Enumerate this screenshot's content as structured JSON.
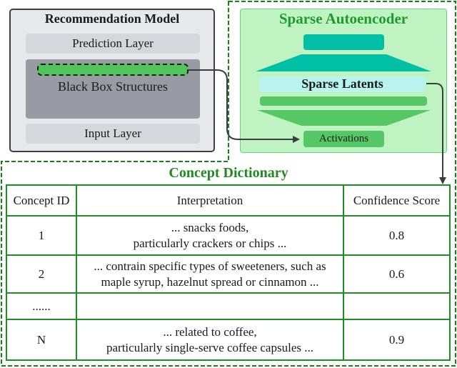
{
  "recommendation_model": {
    "title": "Recommendation Model",
    "prediction_layer": "Prediction Layer",
    "black_box": "Black Box Structures",
    "input_layer": "Input Layer"
  },
  "sparse_autoencoder": {
    "title": "Sparse Autoencoder",
    "latents": "Sparse Latents",
    "activations": "Activations"
  },
  "concept_dictionary": {
    "title": "Concept Dictionary",
    "columns": [
      "Concept ID",
      "Interpretation",
      "Confidence Score"
    ],
    "rows": [
      {
        "id": "1",
        "line1": "...  snacks foods,",
        "line2": "particularly crackers or chips ...",
        "score": "0.8"
      },
      {
        "id": "2",
        "line1": "... contrain specific types of sweeteners, such as",
        "line2": "maple syrup, hazelnut spread or cinnamon ...",
        "score": "0.6"
      },
      {
        "id": "......",
        "line1": "",
        "line2": "",
        "score": ""
      },
      {
        "id": "N",
        "line1": "... related to coffee,",
        "line2": "particularly single-serve coffee capsules ...",
        "score": "0.9"
      }
    ]
  },
  "colors": {
    "dashed_border": "#1a7f1a",
    "sae_fill": "#bff3c2",
    "encoder_teal": "#00bfa5",
    "decoder_green": "#55c765",
    "table_border": "#1e8f25"
  }
}
